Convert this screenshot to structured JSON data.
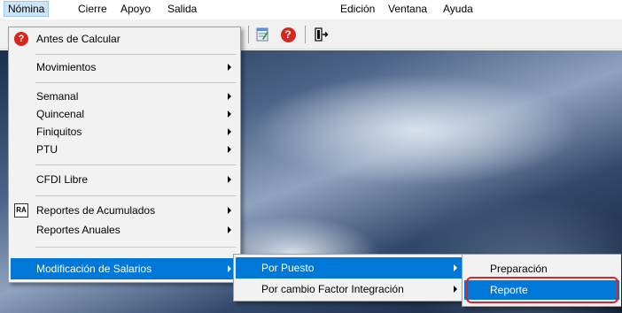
{
  "menubar": {
    "items": [
      "Nómina",
      "Cierre",
      "Apoyo",
      "Salida",
      "Edición",
      "Ventana",
      "Ayuda"
    ]
  },
  "nomina_menu": {
    "items": [
      {
        "label": "Antes de Calcular",
        "icon": "help-icon"
      },
      {
        "label": "Movimientos",
        "submenu": true
      },
      {
        "label": "Semanal",
        "submenu": true
      },
      {
        "label": "Quincenal",
        "submenu": true
      },
      {
        "label": "Finiquitos",
        "submenu": true
      },
      {
        "label": "PTU",
        "submenu": true
      },
      {
        "label": "CFDI Libre",
        "submenu": true
      },
      {
        "label": "Reportes de Acumulados",
        "submenu": true,
        "icon": "ra-icon",
        "icon_text": "RA"
      },
      {
        "label": "Reportes Anuales",
        "submenu": true
      },
      {
        "label": "Modificación de Salarios",
        "submenu": true,
        "highlighted": true
      }
    ]
  },
  "salarios_submenu": {
    "items": [
      {
        "label": "Por Puesto",
        "submenu": true,
        "highlighted": true
      },
      {
        "label": "Por cambio Factor Integración",
        "submenu": true
      }
    ]
  },
  "puesto_submenu": {
    "items": [
      {
        "label": "Preparación"
      },
      {
        "label": "Reporte",
        "highlighted": true
      }
    ]
  },
  "toolbar": {
    "help_glyph": "?"
  },
  "colors": {
    "highlight": "#0078d7",
    "annotation_ring": "#e0202a",
    "menu_bg": "#f2f2f2"
  }
}
